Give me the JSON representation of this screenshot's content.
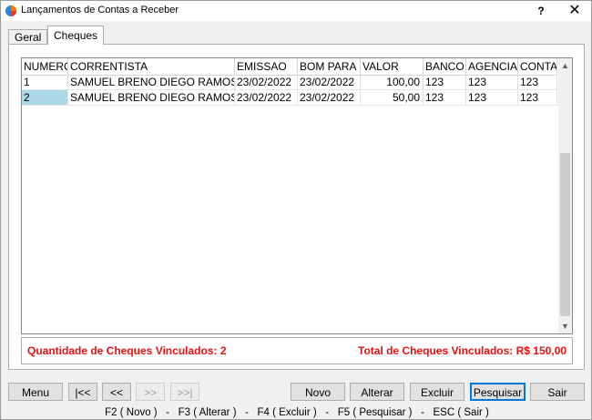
{
  "window": {
    "title": "Lançamentos de Contas a Receber",
    "help_label": "?",
    "close_label": "✕"
  },
  "tabs": [
    {
      "label": "Geral",
      "active": false
    },
    {
      "label": "Cheques",
      "active": true
    }
  ],
  "grid": {
    "columns": [
      "NUMERO",
      "CORRENTISTA",
      "EMISSAO",
      "BOM PARA",
      "VALOR",
      "BANCO",
      "AGENCIA",
      "CONTA"
    ],
    "rows": [
      [
        "1",
        "SAMUEL BRENO DIEGO RAMOS",
        "23/02/2022",
        "23/02/2022",
        "100,00",
        "123",
        "123",
        "123"
      ],
      [
        "2",
        "SAMUEL BRENO DIEGO RAMOS",
        "23/02/2022",
        "23/02/2022",
        "50,00",
        "123",
        "123",
        "123"
      ]
    ],
    "selected_row": 1
  },
  "summary": {
    "quantity": "Quantidade de Cheques Vinculados: 2",
    "total": "Total de Cheques Vinculados: R$ 150,00"
  },
  "buttons": {
    "menu": "Menu",
    "first": "|<<",
    "prev": "<<",
    "next": ">>",
    "last": ">>|",
    "novo": "Novo",
    "alterar": "Alterar",
    "excluir": "Excluir",
    "pesquisar": "Pesquisar",
    "sair": "Sair"
  },
  "shortcuts": "F2 ( Novo )   -   F3 ( Alterar )   -   F4 ( Excluir )   -   F5 ( Pesquisar )   -   ESC ( Sair )",
  "colors": {
    "summary_text": "#e81010",
    "selection": "#add8e6",
    "focus_border": "#0078d7"
  },
  "icons": {
    "app": "app-logo-icon",
    "scroll_up": "chevron-up-icon",
    "scroll_down": "chevron-down-icon"
  }
}
